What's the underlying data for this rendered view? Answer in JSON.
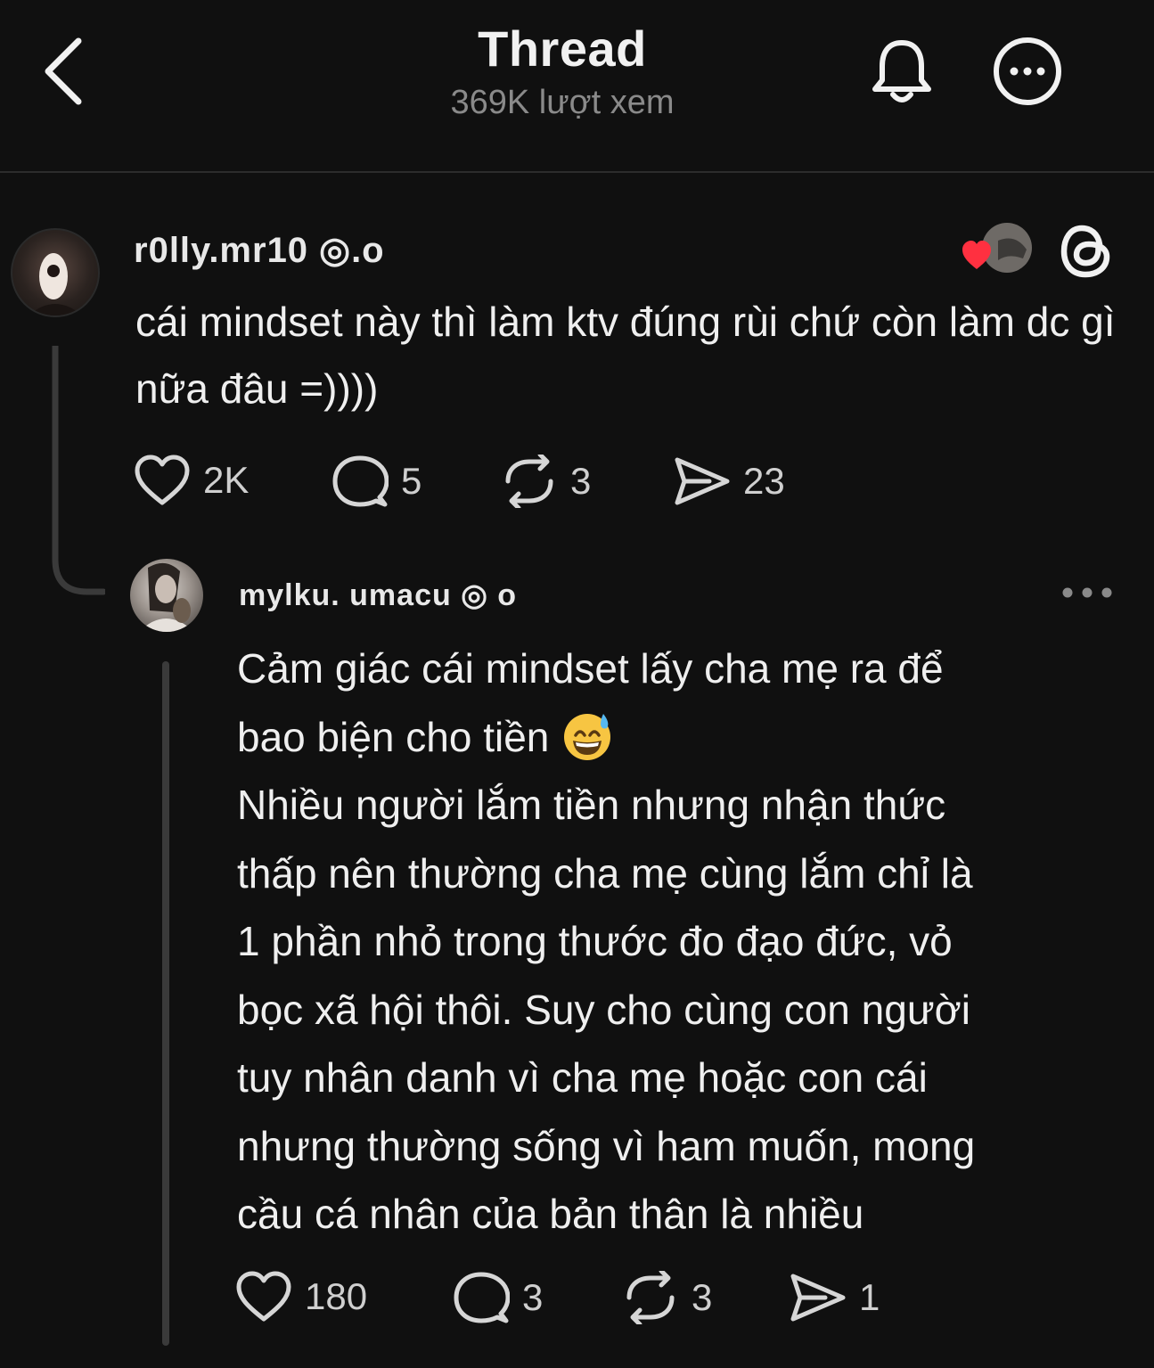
{
  "header": {
    "title": "Thread",
    "views": "369K lượt xem"
  },
  "post": {
    "username": "r0lly.mr10 ◎.o",
    "text": "cái mindset này thì làm ktv đúng rùi chứ còn làm dc gì nữa đâu =))))",
    "likes": "2K",
    "comments": "5",
    "reposts": "3",
    "shares": "23"
  },
  "reply": {
    "username": "mylku. umacu ◎ o",
    "text_lines": [
      "Cảm giác cái mindset lấy cha mẹ ra để",
      "bao biện cho tiền",
      "Nhiều người lắm tiền nhưng nhận thức",
      "thấp nên thường cha mẹ cùng lắm chỉ là",
      "1 phần nhỏ trong thước đo đạo đức, vỏ",
      "bọc xã hội thôi. Suy cho cùng con người",
      "tuy nhân danh vì cha mẹ hoặc con cái",
      "nhưng thường sống vì ham muốn, mong",
      "cầu cá nhân của bản thân là nhiều"
    ],
    "likes": "180",
    "comments": "3",
    "reposts": "3",
    "shares": "1"
  },
  "icons": {
    "back": "chevron-left-icon",
    "bell": "bell-icon",
    "more": "more-circle-icon",
    "threads": "threads-logo-icon",
    "heart": "heart-icon",
    "comment": "comment-icon",
    "repost": "repost-icon",
    "share": "send-icon",
    "emoji": "grinning-sweat-emoji"
  },
  "colors": {
    "background": "#101010",
    "text": "#efefef",
    "muted": "#8a8a8a",
    "like_red": "#ff3040"
  }
}
